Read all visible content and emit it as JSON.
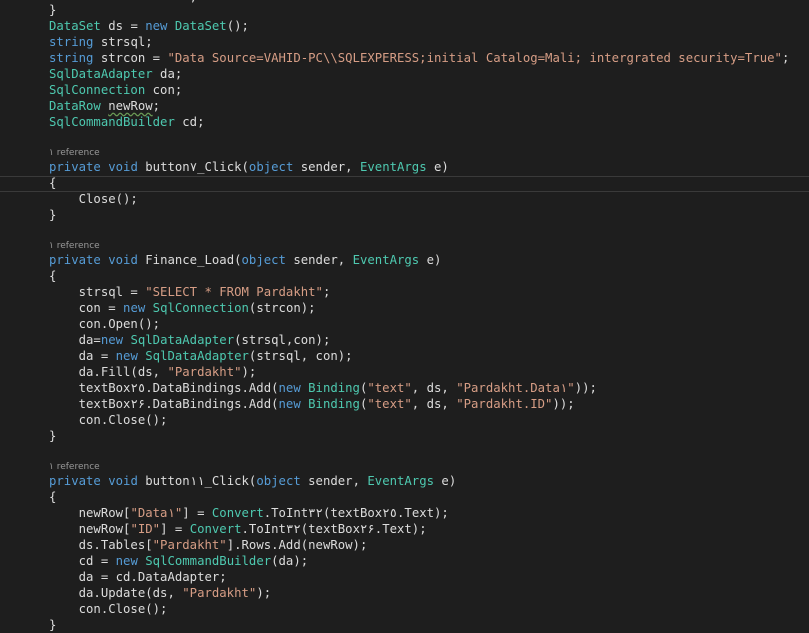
{
  "colors": {
    "background": "#1e1e1e",
    "keyword": "#569cd6",
    "type": "#4ec9b0",
    "string": "#d69d85",
    "text": "#dcdcdc",
    "codelens": "#999999"
  },
  "code": {
    "top_partial": "                   ,",
    "lines": [
      [
        {
          "t": "}",
          "c": "pl"
        }
      ],
      [
        {
          "t": "DataSet",
          "c": "ty"
        },
        {
          "t": " ds = ",
          "c": "pl"
        },
        {
          "t": "new",
          "c": "kw"
        },
        {
          "t": " ",
          "c": "pl"
        },
        {
          "t": "DataSet",
          "c": "ty"
        },
        {
          "t": "();",
          "c": "pl"
        }
      ],
      [
        {
          "t": "string",
          "c": "kw"
        },
        {
          "t": " strsql;",
          "c": "pl"
        }
      ],
      [
        {
          "t": "string",
          "c": "kw"
        },
        {
          "t": " strcon = ",
          "c": "pl"
        },
        {
          "t": "\"Data Source=VAHID-PC\\\\SQLEXPERESS;initial Catalog=Mali; intergrated security=True\"",
          "c": "st"
        },
        {
          "t": ";",
          "c": "pl"
        }
      ],
      [
        {
          "t": "SqlDataAdapter",
          "c": "ty"
        },
        {
          "t": " da;",
          "c": "pl"
        }
      ],
      [
        {
          "t": "SqlConnection",
          "c": "ty"
        },
        {
          "t": " con;",
          "c": "pl"
        }
      ],
      [
        {
          "t": "DataRow",
          "c": "ty"
        },
        {
          "t": " ",
          "c": "pl"
        },
        {
          "t": "newRow",
          "c": "pl",
          "sq": true
        },
        {
          "t": ";",
          "c": "pl"
        }
      ],
      [
        {
          "t": "SqlCommandBuilder",
          "c": "ty"
        },
        {
          "t": " cd;",
          "c": "pl"
        }
      ],
      [],
      [
        {
          "t": "private",
          "c": "kw"
        },
        {
          "t": " ",
          "c": "pl"
        },
        {
          "t": "void",
          "c": "kw"
        },
        {
          "t": " button٧_Click(",
          "c": "pl"
        },
        {
          "t": "object",
          "c": "kw"
        },
        {
          "t": " sender, ",
          "c": "pl"
        },
        {
          "t": "EventArgs",
          "c": "ty"
        },
        {
          "t": " e)",
          "c": "pl"
        }
      ],
      [
        {
          "t": "{",
          "c": "pl"
        }
      ],
      [
        {
          "t": "    Close();",
          "c": "pl"
        }
      ],
      [
        {
          "t": "}",
          "c": "pl"
        }
      ],
      [],
      [
        {
          "t": "private",
          "c": "kw"
        },
        {
          "t": " ",
          "c": "pl"
        },
        {
          "t": "void",
          "c": "kw"
        },
        {
          "t": " Finance_Load(",
          "c": "pl"
        },
        {
          "t": "object",
          "c": "kw"
        },
        {
          "t": " sender, ",
          "c": "pl"
        },
        {
          "t": "EventArgs",
          "c": "ty"
        },
        {
          "t": " e)",
          "c": "pl"
        }
      ],
      [
        {
          "t": "{",
          "c": "pl"
        }
      ],
      [
        {
          "t": "    strsql = ",
          "c": "pl"
        },
        {
          "t": "\"SELECT * FROM Pardakht\"",
          "c": "st"
        },
        {
          "t": ";",
          "c": "pl"
        }
      ],
      [
        {
          "t": "    con = ",
          "c": "pl"
        },
        {
          "t": "new",
          "c": "kw"
        },
        {
          "t": " ",
          "c": "pl"
        },
        {
          "t": "SqlConnection",
          "c": "ty"
        },
        {
          "t": "(strcon);",
          "c": "pl"
        }
      ],
      [
        {
          "t": "    con.Open();",
          "c": "pl"
        }
      ],
      [
        {
          "t": "    da=",
          "c": "pl"
        },
        {
          "t": "new",
          "c": "kw"
        },
        {
          "t": " ",
          "c": "pl"
        },
        {
          "t": "SqlDataAdapter",
          "c": "ty"
        },
        {
          "t": "(strsql,con);",
          "c": "pl"
        }
      ],
      [
        {
          "t": "    da = ",
          "c": "pl"
        },
        {
          "t": "new",
          "c": "kw"
        },
        {
          "t": " ",
          "c": "pl"
        },
        {
          "t": "SqlDataAdapter",
          "c": "ty"
        },
        {
          "t": "(strsql, con);",
          "c": "pl"
        }
      ],
      [
        {
          "t": "    da.Fill(ds, ",
          "c": "pl"
        },
        {
          "t": "\"Pardakht\"",
          "c": "st"
        },
        {
          "t": ");",
          "c": "pl"
        }
      ],
      [
        {
          "t": "    textBox٢٥.DataBindings.Add(",
          "c": "pl"
        },
        {
          "t": "new",
          "c": "kw"
        },
        {
          "t": " ",
          "c": "pl"
        },
        {
          "t": "Binding",
          "c": "ty"
        },
        {
          "t": "(",
          "c": "pl"
        },
        {
          "t": "\"text\"",
          "c": "st"
        },
        {
          "t": ", ds, ",
          "c": "pl"
        },
        {
          "t": "\"Pardakht.Data١\"",
          "c": "st"
        },
        {
          "t": "));",
          "c": "pl"
        }
      ],
      [
        {
          "t": "    textBox٢۶.DataBindings.Add(",
          "c": "pl"
        },
        {
          "t": "new",
          "c": "kw"
        },
        {
          "t": " ",
          "c": "pl"
        },
        {
          "t": "Binding",
          "c": "ty"
        },
        {
          "t": "(",
          "c": "pl"
        },
        {
          "t": "\"text\"",
          "c": "st"
        },
        {
          "t": ", ds, ",
          "c": "pl"
        },
        {
          "t": "\"Pardakht.ID\"",
          "c": "st"
        },
        {
          "t": "));",
          "c": "pl"
        }
      ],
      [
        {
          "t": "    con.Close();",
          "c": "pl"
        }
      ],
      [
        {
          "t": "}",
          "c": "pl"
        }
      ],
      [],
      [
        {
          "t": "private",
          "c": "kw"
        },
        {
          "t": " ",
          "c": "pl"
        },
        {
          "t": "void",
          "c": "kw"
        },
        {
          "t": " button١١_Click(",
          "c": "pl"
        },
        {
          "t": "object",
          "c": "kw"
        },
        {
          "t": " sender, ",
          "c": "pl"
        },
        {
          "t": "EventArgs",
          "c": "ty"
        },
        {
          "t": " e)",
          "c": "pl"
        }
      ],
      [
        {
          "t": "{",
          "c": "pl"
        }
      ],
      [
        {
          "t": "    newRow[",
          "c": "pl"
        },
        {
          "t": "\"Data١\"",
          "c": "st"
        },
        {
          "t": "] = ",
          "c": "pl"
        },
        {
          "t": "Convert",
          "c": "ty"
        },
        {
          "t": ".ToInt٣٢(textBox٢٥.Text);",
          "c": "pl"
        }
      ],
      [
        {
          "t": "    newRow[",
          "c": "pl"
        },
        {
          "t": "\"ID\"",
          "c": "st"
        },
        {
          "t": "] = ",
          "c": "pl"
        },
        {
          "t": "Convert",
          "c": "ty"
        },
        {
          "t": ".ToInt٣٢(textBox٢۶.Text);",
          "c": "pl"
        }
      ],
      [
        {
          "t": "    ds.Tables[",
          "c": "pl"
        },
        {
          "t": "\"Pardakht\"",
          "c": "st"
        },
        {
          "t": "].Rows.Add(newRow);",
          "c": "pl"
        }
      ],
      [
        {
          "t": "    cd = ",
          "c": "pl"
        },
        {
          "t": "new",
          "c": "kw"
        },
        {
          "t": " ",
          "c": "pl"
        },
        {
          "t": "SqlCommandBuilder",
          "c": "ty"
        },
        {
          "t": "(da);",
          "c": "pl"
        }
      ],
      [
        {
          "t": "    da = cd.DataAdapter;",
          "c": "pl"
        }
      ],
      [
        {
          "t": "    da.Update(ds, ",
          "c": "pl"
        },
        {
          "t": "\"Pardakht\"",
          "c": "st"
        },
        {
          "t": ");",
          "c": "pl"
        }
      ],
      [
        {
          "t": "    con.Close();",
          "c": "pl"
        }
      ],
      [
        {
          "t": "}",
          "c": "pl"
        }
      ]
    ],
    "codelens": [
      "١ reference",
      "١ reference",
      "١ reference"
    ]
  }
}
